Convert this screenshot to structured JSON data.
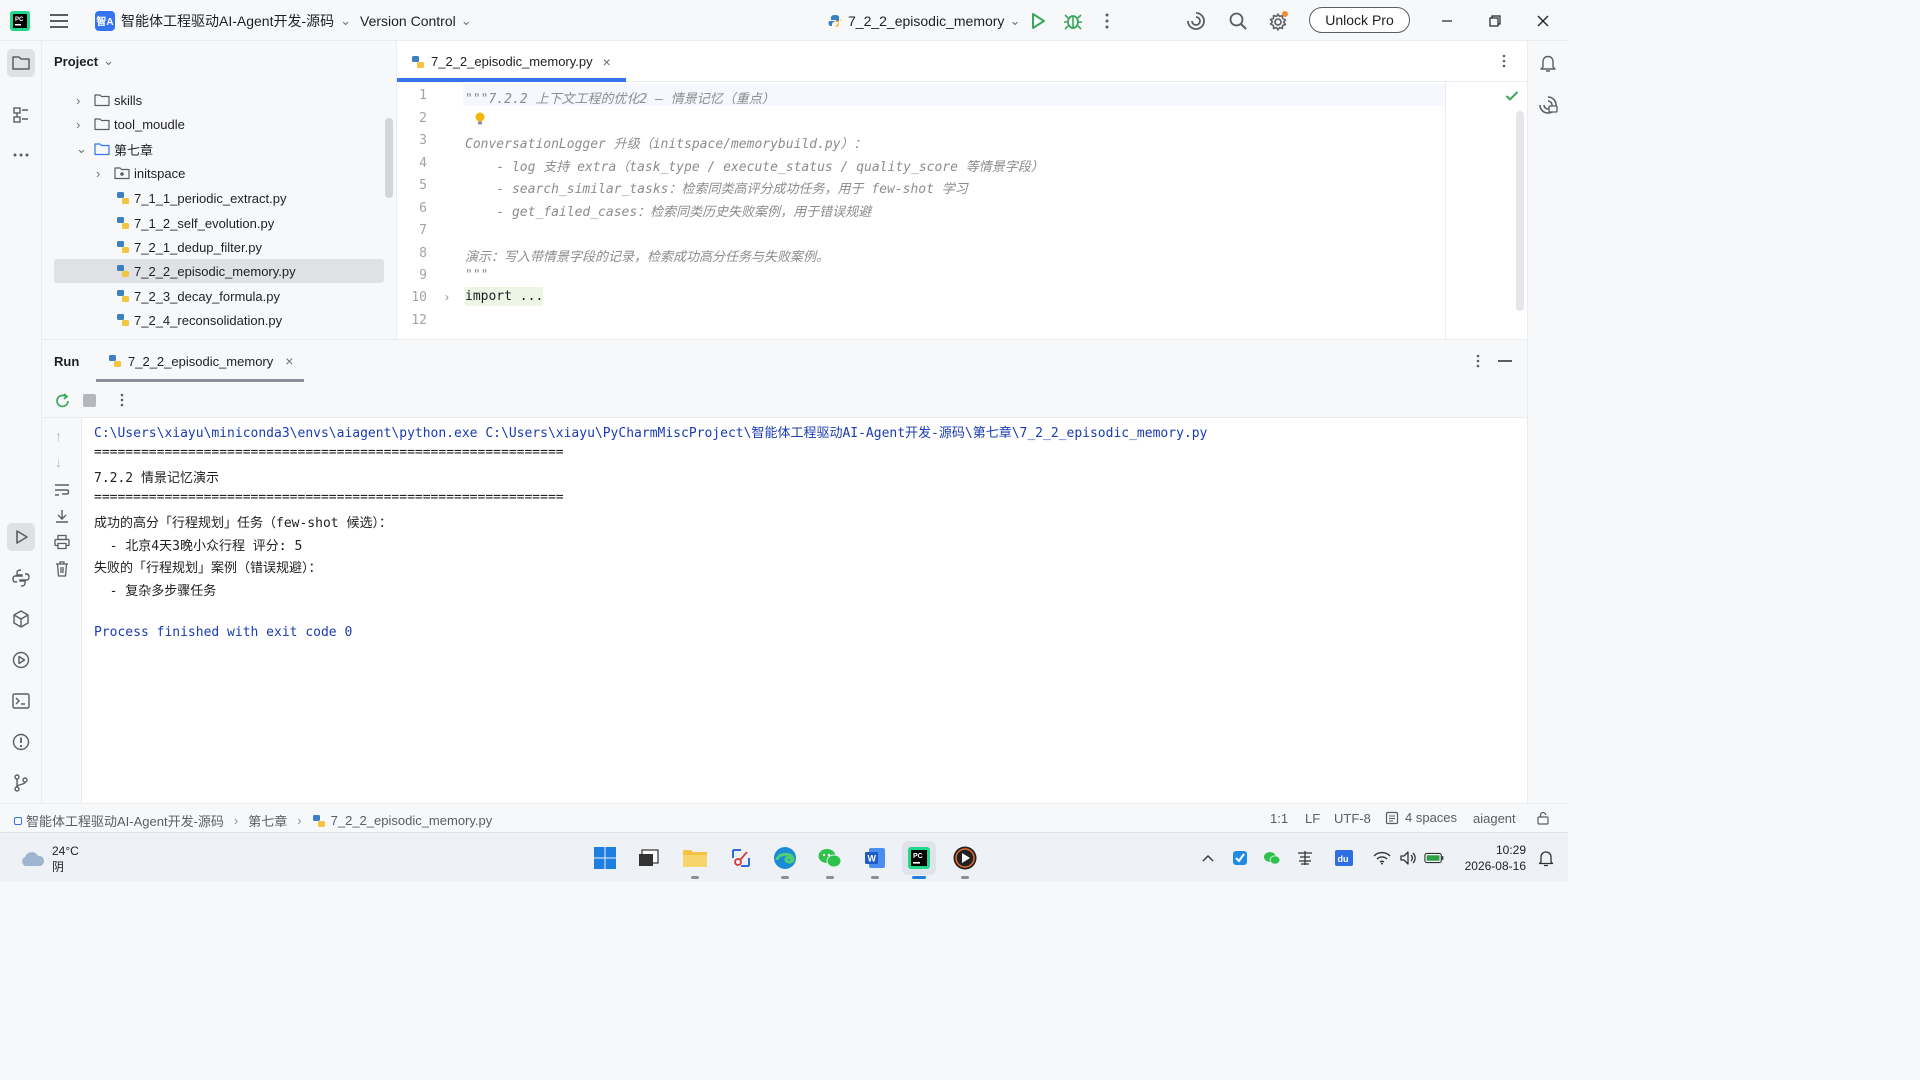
{
  "titlebar": {
    "project_badge": "智A",
    "project_name": "智能体工程驱动AI-Agent开发-源码",
    "vcs_label": "Version Control",
    "run_config": "7_2_2_episodic_memory",
    "unlock_label": "Unlock Pro"
  },
  "project_panel": {
    "title": "Project",
    "items": [
      {
        "label": "skills",
        "type": "folder"
      },
      {
        "label": "tool_moudle",
        "type": "folder"
      },
      {
        "label": "第七章",
        "type": "folder-open"
      },
      {
        "label": "initspace",
        "type": "package"
      },
      {
        "label": "7_1_1_periodic_extract.py",
        "type": "python"
      },
      {
        "label": "7_1_2_self_evolution.py",
        "type": "python"
      },
      {
        "label": "7_2_1_dedup_filter.py",
        "type": "python"
      },
      {
        "label": "7_2_2_episodic_memory.py",
        "type": "python",
        "selected": true
      },
      {
        "label": "7_2_3_decay_formula.py",
        "type": "python"
      },
      {
        "label": "7_2_4_reconsolidation.py",
        "type": "python"
      }
    ]
  },
  "editor": {
    "tab_label": "7_2_2_episodic_memory.py",
    "line_numbers": [
      "1",
      "2",
      "3",
      "4",
      "5",
      "6",
      "7",
      "8",
      "9",
      "10",
      "12"
    ],
    "lines": [
      "\"\"\"7.2.2 上下文工程的优化2 — 情景记忆（重点）",
      "",
      "ConversationLogger 升级（initspace/memorybuild.py）：",
      "    - log 支持 extra（task_type / execute_status / quality_score 等情景字段）",
      "    - search_similar_tasks：检索同类高评分成功任务，用于 few-shot 学习",
      "    - get_failed_cases：检索同类历史失败案例，用于错误规避",
      "",
      "演示：写入带情景字段的记录，检索成功高分任务与失败案例。",
      "\"\"\"",
      "import ...",
      ""
    ]
  },
  "run_panel": {
    "title": "Run",
    "tab_label": "7_2_2_episodic_memory",
    "output": [
      "C:\\Users\\xiayu\\miniconda3\\envs\\aiagent\\python.exe C:\\Users\\xiayu\\PyCharmMiscProject\\智能体工程驱动AI-Agent开发-源码\\第七章\\7_2_2_episodic_memory.py",
      "============================================================",
      "7.2.2 情景记忆演示",
      "============================================================",
      "成功的高分「行程规划」任务（few-shot 候选）：",
      "  - 北京4天3晚小众行程 评分: 5",
      "失败的「行程规划」案例（错误规避）：",
      "  - 复杂多步骤任务",
      "",
      "Process finished with exit code 0"
    ]
  },
  "statusbar": {
    "crumb_project": "智能体工程驱动AI-Agent开发-源码",
    "crumb_folder": "第七章",
    "crumb_file": "7_2_2_episodic_memory.py",
    "position": "1:1",
    "line_sep": "LF",
    "encoding": "UTF-8",
    "indent": "4 spaces",
    "interpreter": "aiagent"
  },
  "taskbar": {
    "temperature": "24°C",
    "weather": "阴",
    "time": "10:29",
    "date": "2026-08-16"
  },
  "colors": {
    "accent": "#3574f0",
    "run_green": "#3ba55c",
    "output_blue": "#1a3bb3"
  }
}
